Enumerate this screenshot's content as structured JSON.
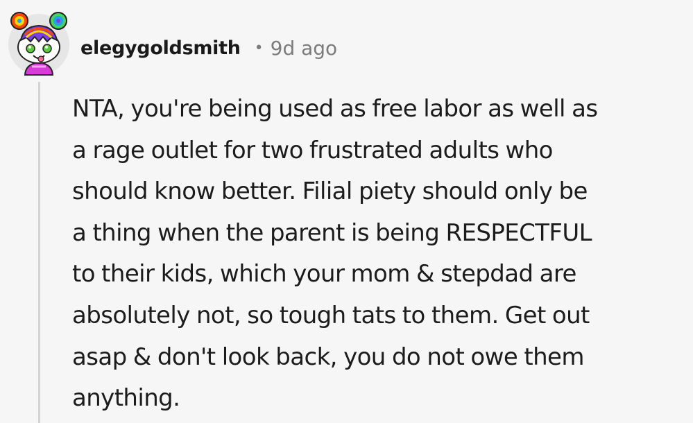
{
  "comment": {
    "username": "elegygoldsmith",
    "separator": "•",
    "timestamp": "9d ago",
    "body_lines": [
      "NTA, you're being used as free labor as well as",
      "a rage outlet for two frustrated adults who",
      "should know better. Filial piety should only be",
      "a thing when the parent is being RESPECTFUL",
      "to their kids, which your mom & stepdad are",
      "absolutely not, so tough tats to them. Get out",
      "asap & don't look back, you do not owe them",
      "anything."
    ]
  },
  "avatar": {
    "icon": "snoo-avatar-icon",
    "skin_color": "#ffffff",
    "eye_color": "#5ecb3c",
    "shirt_color": "#d93cd6",
    "background_color": "#e6e6e6",
    "hair_colors": [
      "#ff4500",
      "#ffd400",
      "#46d160",
      "#24a0ed",
      "#7b3fe4"
    ]
  }
}
